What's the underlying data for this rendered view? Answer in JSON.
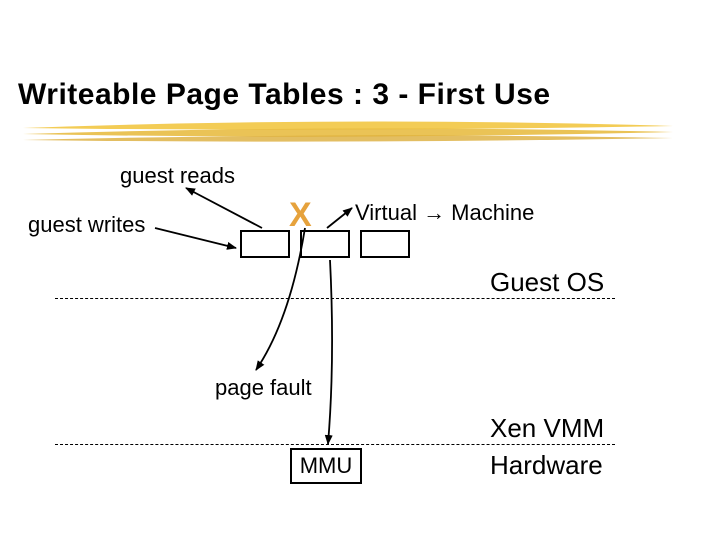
{
  "title": "Writeable Page Tables : 3 - First Use",
  "labels": {
    "guest_reads": "guest reads",
    "guest_writes": "guest writes",
    "virtual_machine": "Virtual → Machine",
    "page_fault": "page fault",
    "guest_os": "Guest OS",
    "xen_vmm": "Xen VMM",
    "hardware": "Hardware",
    "mmu": "MMU",
    "x": "X"
  }
}
